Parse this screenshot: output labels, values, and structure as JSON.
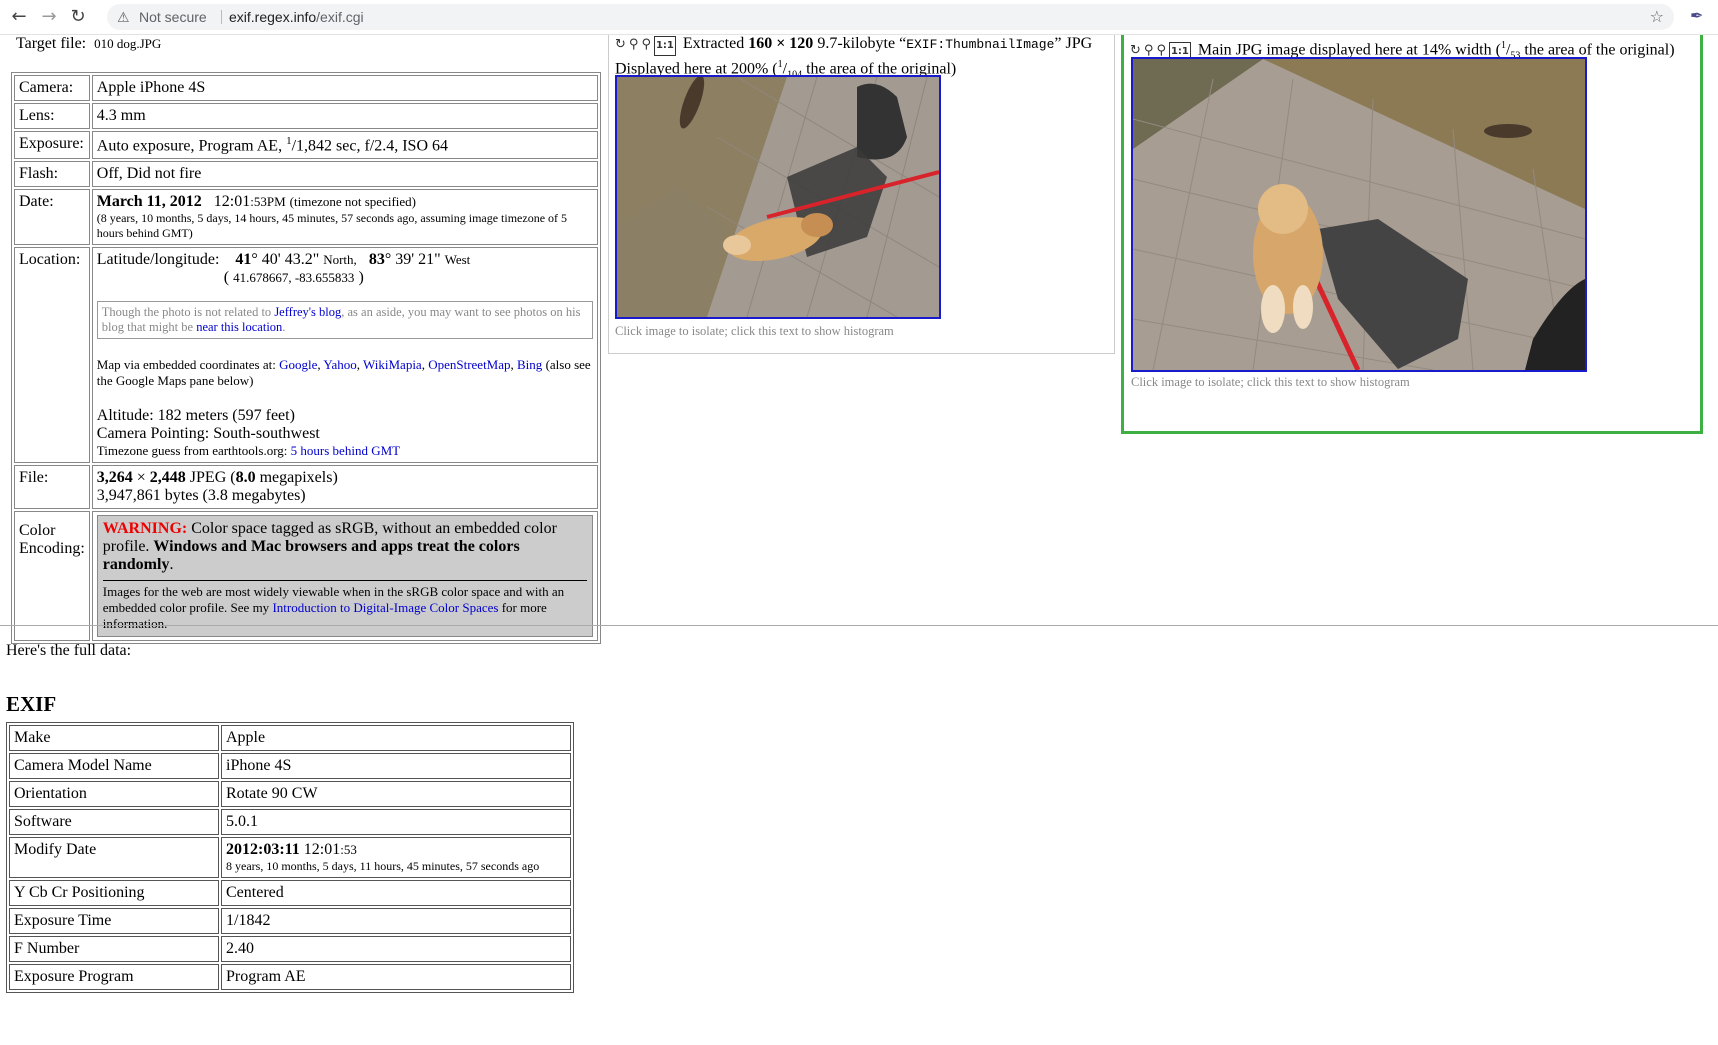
{
  "browser": {
    "back_icon": "arrow-left-icon",
    "forward_icon": "arrow-right-icon",
    "reload_icon": "reload-icon",
    "security": "Not secure",
    "url_host": "exif.regex.info",
    "url_path": "/exif.cgi",
    "star_icon": "star-icon",
    "extension_icon": "eyedropper-icon"
  },
  "summary": {
    "target_label": "Target file:",
    "target_file": "010 dog.JPG",
    "camera_label": "Camera:",
    "camera_value": "Apple iPhone 4S",
    "lens_label": "Lens:",
    "lens_value": "4.3 mm",
    "exposure_label": "Exposure:",
    "exposure_prefix": "Auto exposure, Program AE, ",
    "exposure_num": "1",
    "exposure_den": "/1,842 sec, f/2.4, ISO 64",
    "flash_label": "Flash:",
    "flash_value": "Off, Did not fire",
    "date_label": "Date:",
    "date_bold": "March 11, 2012",
    "date_time": "12:01",
    "date_secs": ":53PM",
    "date_tz": "(timezone not specified)",
    "date_ago": "(8 years, 10 months, 5 days, 14 hours, 45 minutes, 57 seconds ago, assuming image timezone of 5 hours behind GMT)",
    "location_label": "Location:",
    "latlon_label": "Latitude/longitude:",
    "lat_deg": "41",
    "lat_rest": "° 40' 43.2\"",
    "lat_dir": "North,",
    "lon_deg": "83",
    "lon_rest": "° 39' 21\"",
    "lon_dir": "West",
    "decimal_coords": "41.678667, -83.655833",
    "aside_pre": "Though the photo is not related to ",
    "aside_link1": "Jeffrey's blog",
    "aside_mid": ", as an aside, you may want to see photos on his blog that might be ",
    "aside_link2": "near this location",
    "aside_end": ".",
    "map_pre": "Map via embedded coordinates at: ",
    "map_links": [
      "Google",
      "Yahoo",
      "WikiMapia",
      "OpenStreetMap",
      "Bing"
    ],
    "map_post": " (also see the Google Maps pane below)",
    "altitude": "Altitude: 182 meters (597 feet)",
    "pointing": "Camera Pointing: South-southwest",
    "tz_pre": "Timezone guess from earthtools.org: ",
    "tz_link": "5 hours behind GMT",
    "file_label": "File:",
    "file_dim_a": "3,264",
    "file_dim_x": " × ",
    "file_dim_b": "2,448",
    "file_type": " JPEG (",
    "file_mp": "8.0",
    "file_mp_unit": " megapixels)",
    "file_bytes": "3,947,861 bytes (3.8 megabytes)",
    "color_label": "Color Encoding:",
    "warn_word": "WARNING:",
    "warn_text": " Color space tagged as sRGB, without an embedded color profile. ",
    "warn_bold": "Windows and Mac browsers and apps treat the colors randomly",
    "warn_end": ".",
    "warn_note_pre": "Images for the web are most widely viewable when in the sRGB color space and with an embedded color profile. See my ",
    "warn_note_link": "Introduction to Digital-Image Color Spaces",
    "warn_note_post": " for more information."
  },
  "thumb": {
    "extracted": "Extracted ",
    "dims": "160 × 120",
    "size": " 9.7-kilobyte “",
    "tag": "EXIF:ThumbnailImage",
    "tag_end": "” JPG",
    "display": "Displayed here at 200% (",
    "frac_num": "1",
    "frac_den": "104",
    "display_end": " the area of the original)",
    "isolate": "Click image to isolate; click this text to show histogram"
  },
  "main_image": {
    "caption": "Main JPG image displayed here at 14% width (",
    "frac_num": "1",
    "frac_den": "53",
    "caption_end": " the area of the original)",
    "isolate": "Click image to isolate; click this text to show histogram"
  },
  "full_data_label": "Here's the full data:",
  "exif_heading": "EXIF",
  "exif_rows": [
    {
      "key": "Make",
      "value": "Apple"
    },
    {
      "key": "Camera Model Name",
      "value": "iPhone 4S"
    },
    {
      "key": "Orientation",
      "value": "Rotate 90 CW"
    },
    {
      "key": "Software",
      "value": "5.0.1"
    },
    {
      "key": "Modify Date",
      "value_bold": "2012:03:11",
      "value_time": " 12:01",
      "value_secs": ":53",
      "value_sub": "8 years, 10 months, 5 days, 11 hours, 45 minutes, 57 seconds ago"
    },
    {
      "key": "Y Cb Cr Positioning",
      "value": "Centered"
    },
    {
      "key": "Exposure Time",
      "value": "1/1842"
    },
    {
      "key": "F Number",
      "value": "2.40"
    },
    {
      "key": "Exposure Program",
      "value": "Program AE"
    }
  ]
}
